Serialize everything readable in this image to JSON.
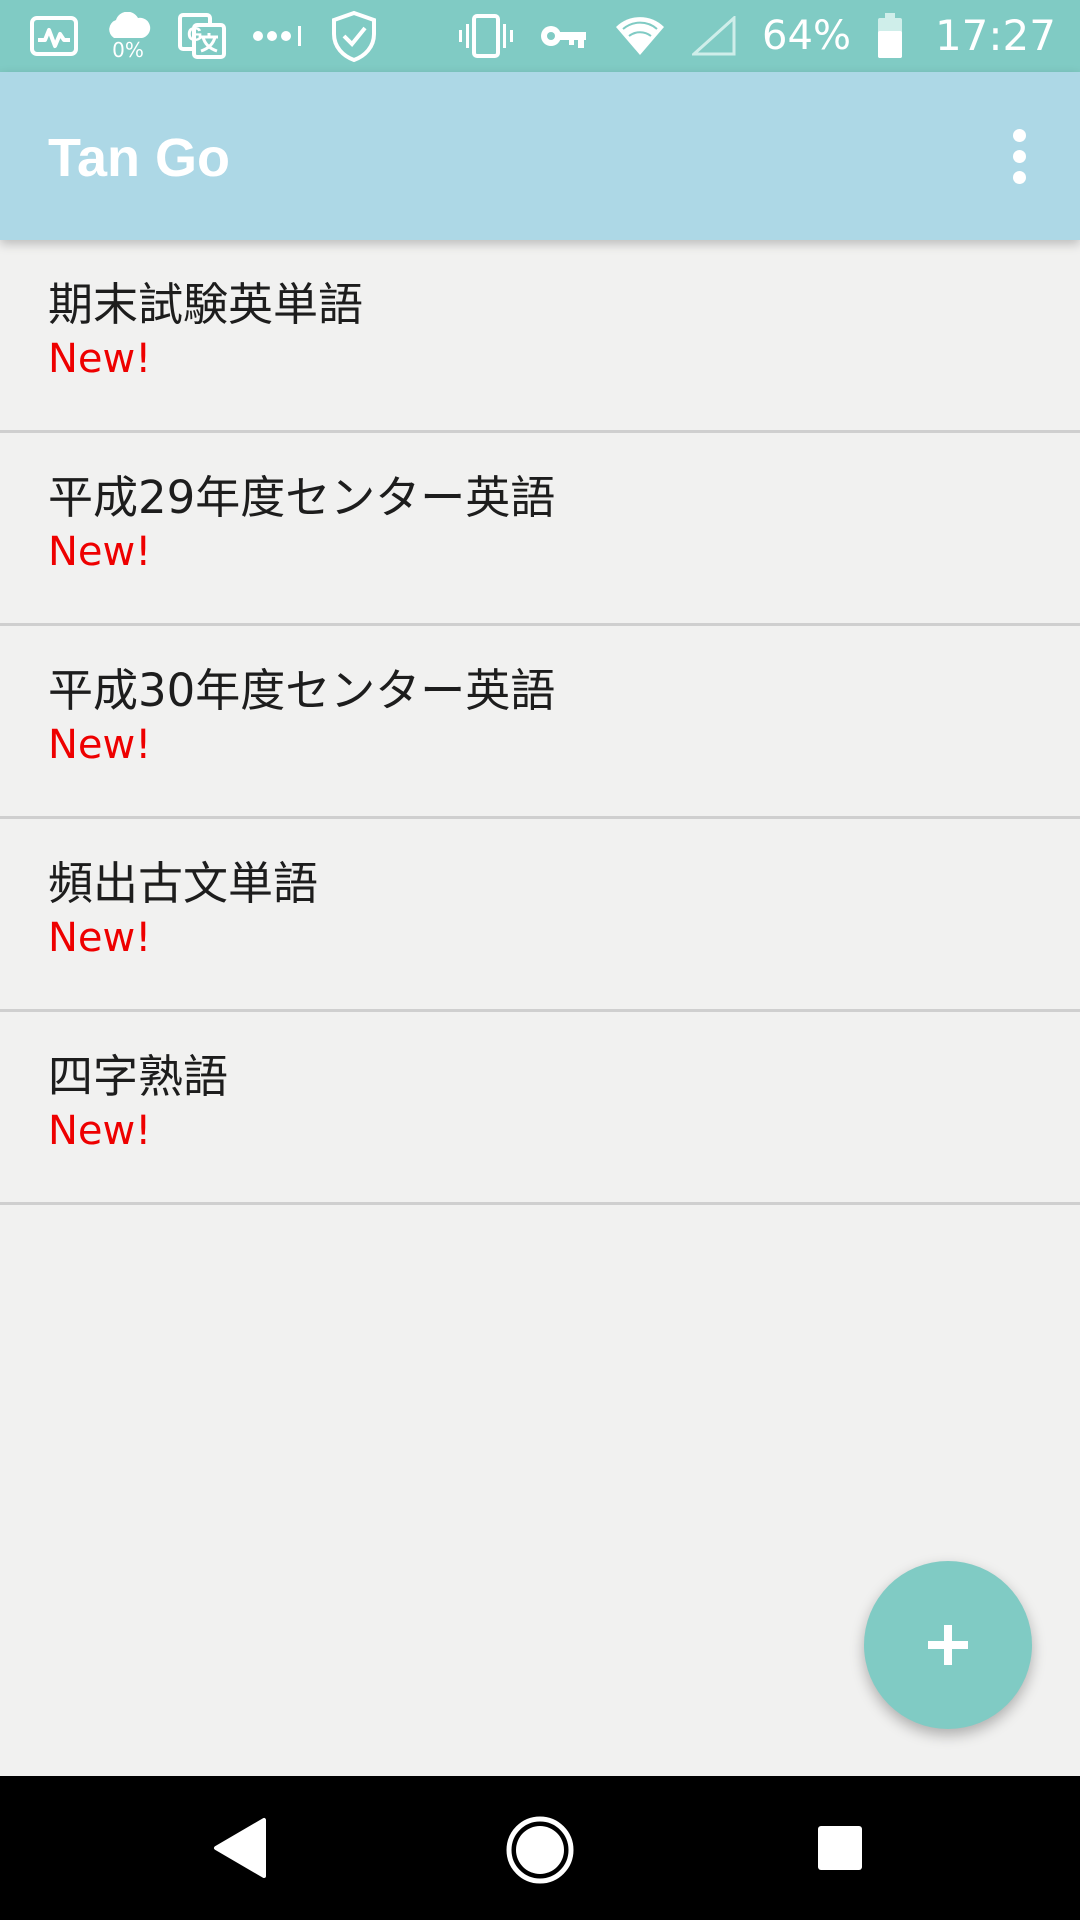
{
  "status_bar": {
    "data_saver_text": "0%",
    "battery_text": "64%",
    "time": "17:27",
    "icons": [
      "activity-monitor-icon",
      "data-saver-icon",
      "translate-icon",
      "more-dots-icon",
      "shield-check-icon",
      "vibrate-icon",
      "vpn-key-icon",
      "wifi-icon",
      "cell-signal-icon",
      "battery-icon"
    ]
  },
  "app_bar": {
    "title": "Tan Go",
    "menu_icon": "more-vert-icon"
  },
  "list": {
    "items": [
      {
        "title": "期末試験英単語",
        "badge": "New!"
      },
      {
        "title": "平成29年度センター英語",
        "badge": "New!"
      },
      {
        "title": "平成30年度センター英語",
        "badge": "New!"
      },
      {
        "title": "頻出古文単語",
        "badge": "New!"
      },
      {
        "title": "四字熟語",
        "badge": "New!"
      }
    ]
  },
  "fab": {
    "icon": "plus-icon"
  },
  "nav_bar": {
    "icons": [
      "back-icon",
      "home-icon",
      "recents-icon"
    ]
  },
  "colors": {
    "status_bar": "#80cbc4",
    "app_bar": "#add8e6",
    "badge": "#ee0000",
    "fab": "#80cbc4",
    "background": "#f1f1f0"
  }
}
